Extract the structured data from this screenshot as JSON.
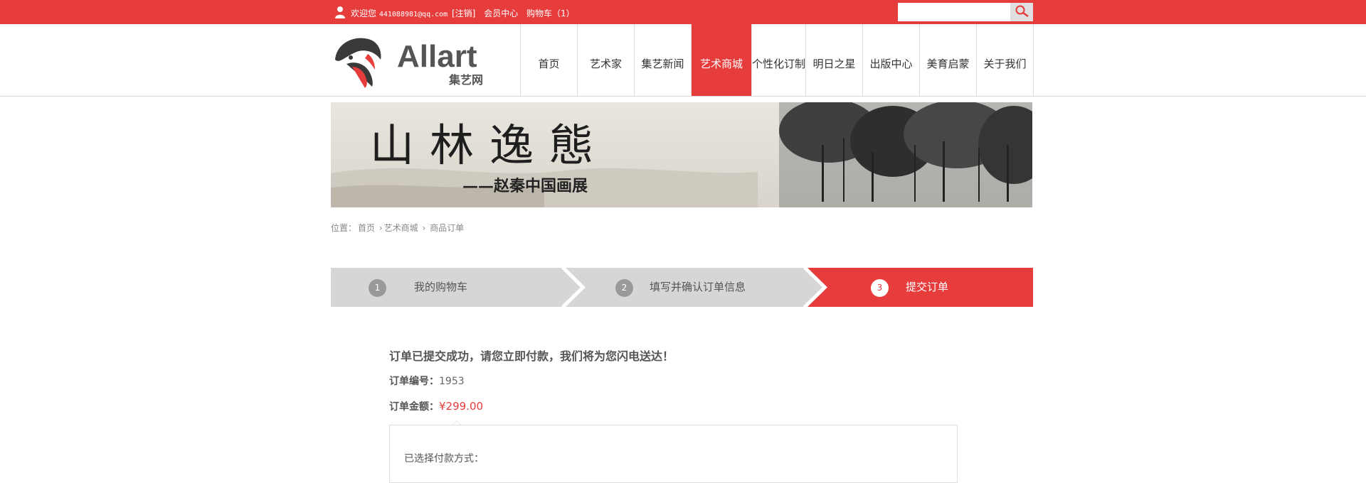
{
  "topbar": {
    "welcome_prefix": "欢迎您",
    "email": "441088981@qq.com",
    "logout": "[注销]",
    "member_center": "会员中心",
    "cart": "购物车（1）",
    "search_placeholder": ""
  },
  "logo": {
    "brand": "Allart",
    "sub": "集艺网"
  },
  "nav": [
    {
      "label": "首页",
      "active": false
    },
    {
      "label": "艺术家",
      "active": false
    },
    {
      "label": "集艺新闻",
      "active": false
    },
    {
      "label": "艺术商城",
      "active": true
    },
    {
      "label": "个性化订制",
      "active": false
    },
    {
      "label": "明日之星",
      "active": false
    },
    {
      "label": "出版中心",
      "active": false
    },
    {
      "label": "美育启蒙",
      "active": false
    },
    {
      "label": "关于我们",
      "active": false
    }
  ],
  "banner": {
    "title": "山林逸態",
    "subtitle": "——赵秦中国画展"
  },
  "breadcrumb": {
    "prefix": "位置：",
    "items": [
      "首页",
      "艺术商城",
      "商品订单"
    ]
  },
  "steps": [
    {
      "num": "1",
      "label": "我的购物车",
      "active": false
    },
    {
      "num": "2",
      "label": "填写并确认订单信息",
      "active": false
    },
    {
      "num": "3",
      "label": "提交订单",
      "active": true
    }
  ],
  "order": {
    "success_message": "订单已提交成功，请您立即付款，我们将为您闪电送达！",
    "number_label": "订单编号：",
    "number_value": "1953",
    "amount_label": "订单金额：",
    "amount_value": "¥299.00",
    "payment_label": "已选择付款方式："
  },
  "colors": {
    "accent": "#e63c3c",
    "step_inactive": "#d6d6d6"
  }
}
